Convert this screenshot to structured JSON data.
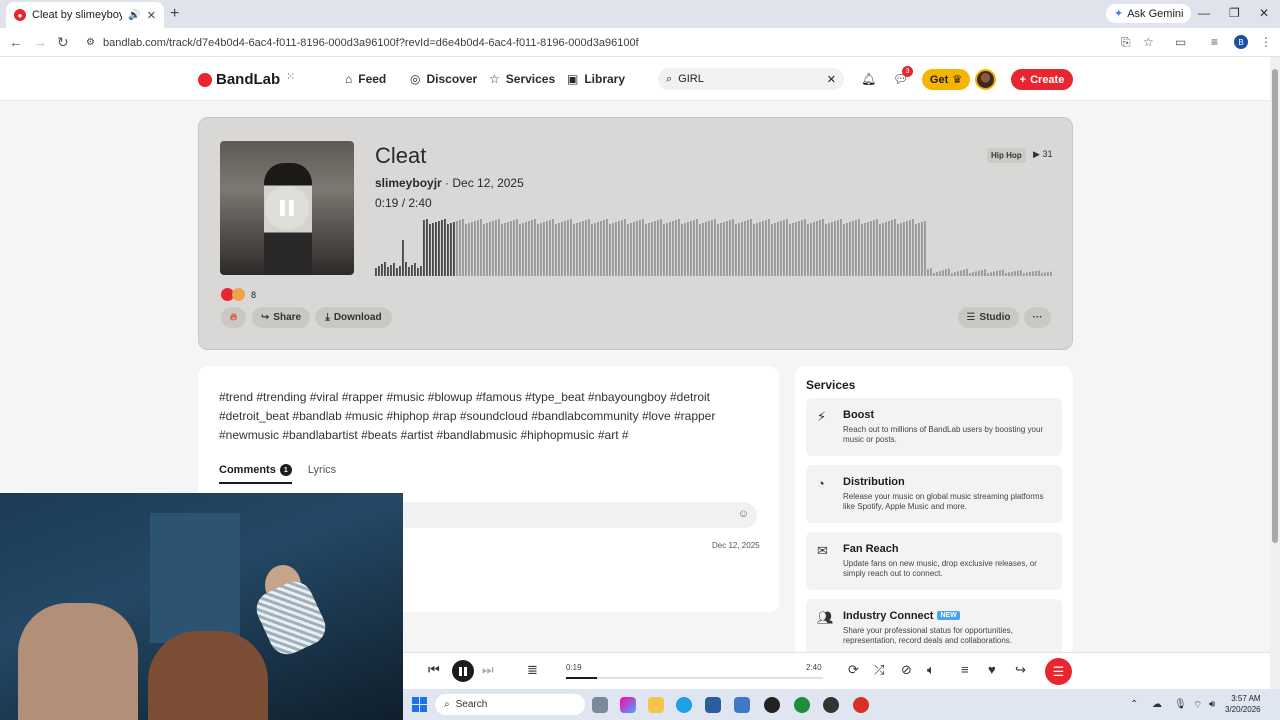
{
  "browser": {
    "tab_title": "Cleat by slimeyboyjr | Band",
    "ask_gemini": "Ask Gemini",
    "url": "bandlab.com/track/d7e4b0d4-6ac4-f011-8196-000d3a96100f?revId=d6e4b0d4-6ac4-f011-8196-000d3a96100f",
    "profile_initial": "B"
  },
  "site": {
    "logo": "BandLab",
    "nav": [
      "Feed",
      "Discover",
      "Services",
      "Library"
    ],
    "search_value": "GIRL",
    "messages_badge": "3",
    "get_label": "Get",
    "create_label": "Create"
  },
  "track": {
    "title": "Cleat",
    "artist": "slimeyboyjr",
    "date": "· Dec 12, 2025",
    "current_time": "0:19 /",
    "duration": "2:40",
    "genre": "Hip Hop",
    "plays": "31",
    "reactions_count": "8",
    "progress": 0.119,
    "share_label": "Share",
    "download_label": "Download",
    "studio_label": "Studio"
  },
  "description": {
    "tags": "#trend #trending #viral #rapper #music #blowup #famous #type_beat #nbayoungboy #detroit #detroit_beat #bandlab   #music #hiphop #rap #soundcloud #bandlabcommunity #love #rapper #newmusic #bandlabartist #beats #artist #bandlabmusic #hiphopmusic #art #",
    "tab_comments": "Comments",
    "comments_count": "1",
    "tab_lyrics": "Lyrics",
    "comment_date": "Dec 12, 2025"
  },
  "services": {
    "heading": "Services",
    "items": [
      {
        "name": "Boost",
        "desc": "Reach out to millions of BandLab users by boosting your music or posts.",
        "icon": "bolt-icon"
      },
      {
        "name": "Distribution",
        "desc": "Release your music on global music streaming platforms like Spotify, Apple Music and more.",
        "icon": "distribution-icon"
      },
      {
        "name": "Fan Reach",
        "desc": "Update fans on new music, drop exclusive releases, or simply reach out to connect.",
        "icon": "mail-icon"
      },
      {
        "name": "Industry Connect",
        "desc": "Share your professional status for opportunities, representation, record deals and collaborations.",
        "icon": "people-icon",
        "badge": "NEW"
      }
    ]
  },
  "player": {
    "current": "0:19",
    "total": "2:40",
    "progress": 0.119
  },
  "taskbar": {
    "search": "Search",
    "time": "3:57 AM",
    "date": "3/20/2026"
  },
  "colors": {
    "brand_red": "#e8262f",
    "get_yellow": "#f5b400",
    "new_badge_blue": "#4aa3f0"
  }
}
